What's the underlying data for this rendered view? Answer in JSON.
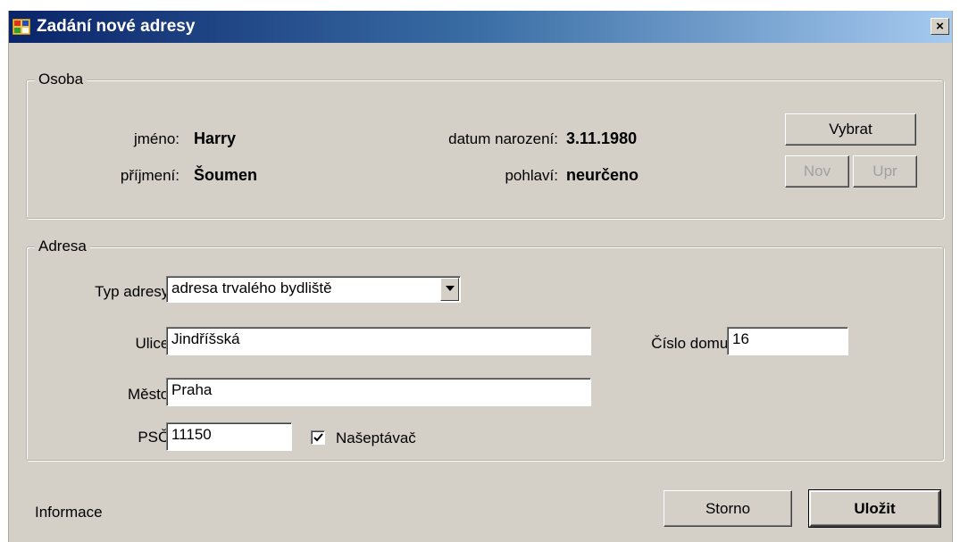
{
  "window": {
    "title": "Zadání nové adresy",
    "close_label": "×"
  },
  "osoba": {
    "legend": "Osoba",
    "jmeno_label": "jméno:",
    "jmeno_value": "Harry",
    "prijmeni_label": "příjmení:",
    "prijmeni_value": "Šoumen",
    "datum_label": "datum narození:",
    "datum_value": "3.11.1980",
    "pohlavi_label": "pohlaví:",
    "pohlavi_value": "neurčeno",
    "vybrat_label": "Vybrat",
    "nov_label": "Nov",
    "upr_label": "Upr"
  },
  "adresa": {
    "legend": "Adresa",
    "typ_label": "Typ adresy:",
    "typ_value": "adresa trvalého bydliště",
    "ulice_label": "Ulice:",
    "ulice_value": "Jindříšská",
    "cislo_label": "Číslo domu:",
    "cislo_value": "16",
    "mesto_label": "Město:",
    "mesto_value": "Praha",
    "psc_label": "PSČ:",
    "psc_value": "11150",
    "naseptavac_label": "Našeptávač",
    "naseptavac_checked": true
  },
  "footer": {
    "info_label": "Informace",
    "storno_label": "Storno",
    "ulozit_label": "Uložit"
  },
  "colors": {
    "window_bg": "#d4d0c8",
    "title_start": "#0a246a",
    "title_end": "#a6caf0"
  },
  "icons": {
    "app": "window-app-icon",
    "close": "close-icon",
    "dropdown": "chevron-down-icon",
    "check": "checkmark-icon"
  }
}
